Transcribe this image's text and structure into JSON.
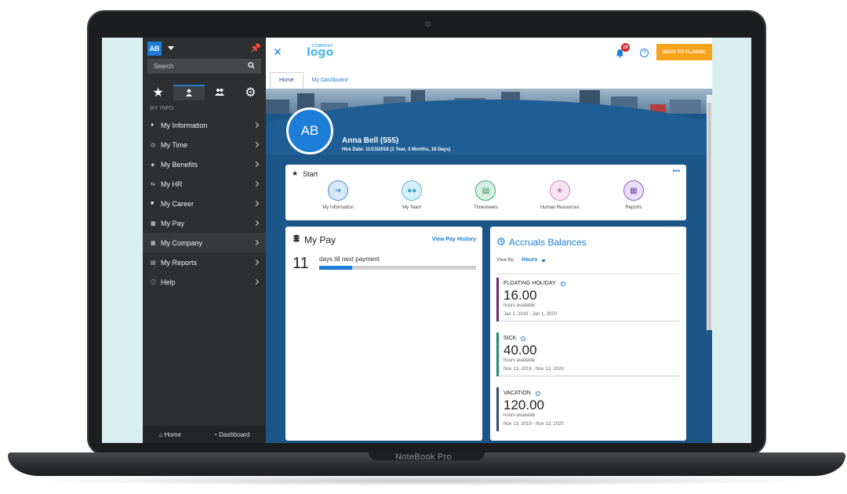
{
  "device": {
    "brand": "NoteBook Pro"
  },
  "colors": {
    "accent": "#1c7ed6",
    "sidebar": "#2e2f31",
    "classic_button": "#f7a21b",
    "notification": "#d6242c"
  },
  "sidebar": {
    "user_initials": "AB",
    "search_placeholder": "Search",
    "section_label": "MY INFO",
    "items": [
      {
        "label": "My Information",
        "icon": "person-icon"
      },
      {
        "label": "My Time",
        "icon": "clock-icon"
      },
      {
        "label": "My Benefits",
        "icon": "shield-icon"
      },
      {
        "label": "My HR",
        "icon": "hr-icon"
      },
      {
        "label": "My Career",
        "icon": "briefcase-icon"
      },
      {
        "label": "My Pay",
        "icon": "money-icon"
      },
      {
        "label": "My Company",
        "icon": "building-icon"
      },
      {
        "label": "My Reports",
        "icon": "report-icon"
      },
      {
        "label": "Help",
        "icon": "help-icon"
      }
    ],
    "footer": {
      "home": "Home",
      "dashboard": "Dashboard"
    }
  },
  "header": {
    "logo_top": "COMPANY",
    "logo_main": "logo",
    "notification_count": "19",
    "back_button": "BACK TO CLASSIC"
  },
  "tabs": [
    "Home",
    "My Dashboard"
  ],
  "profile": {
    "initials": "AB",
    "name": "Anna Bell (555)",
    "hire_date": "Hire Date: 11/13/2018 (1 Year, 3 Months, 18 Days)"
  },
  "start": {
    "title": "Start",
    "more": "•••",
    "tiles": [
      {
        "label": "My Information",
        "icon": "person-arrow-icon",
        "color": "#4a90d9"
      },
      {
        "label": "My Team",
        "icon": "team-icon",
        "color": "#5bb8e0"
      },
      {
        "label": "Timesheets",
        "icon": "timesheet-icon",
        "color": "#3fa873"
      },
      {
        "label": "Human Resources",
        "icon": "star-person-icon",
        "color": "#d08ac9"
      },
      {
        "label": "Reports",
        "icon": "report-chart-icon",
        "color": "#8e5cc7"
      }
    ]
  },
  "pay": {
    "title": "My Pay",
    "link": "View Pay History",
    "days": "11",
    "days_label": "days till next payment",
    "progress": 0.21
  },
  "accruals": {
    "title": "Accruals Balances",
    "view_by_label": "View By:",
    "view_by_value": "Hours",
    "items": [
      {
        "name": "FLOATING HOLIDAY",
        "value": "16.00",
        "unit": "hours available",
        "range": "Jan 1, 2019 - Jan 1, 2020",
        "color": "#6b2a6b"
      },
      {
        "name": "SICK",
        "value": "40.00",
        "unit": "hours available",
        "range": "Nov 13, 2019 - Nov 13, 2020",
        "color": "#1a8a7a"
      },
      {
        "name": "VACATION",
        "value": "120.00",
        "unit": "hours available",
        "range": "Nov 13, 2019 - Nov 13, 2020",
        "color": "#2f4f6f"
      }
    ]
  }
}
